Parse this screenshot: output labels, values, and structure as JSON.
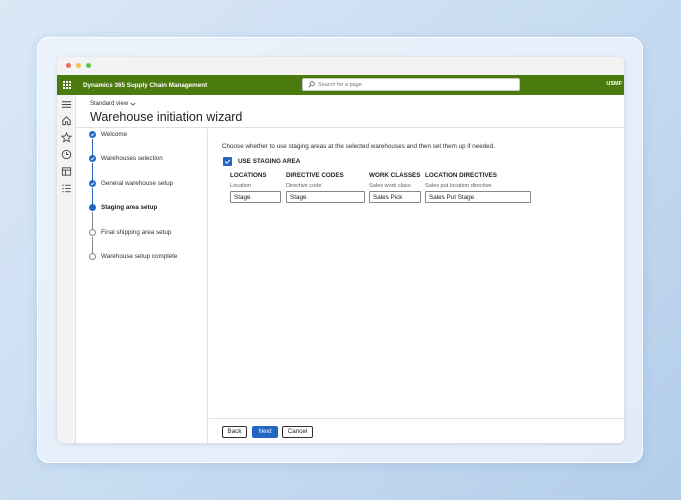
{
  "app": {
    "title": "Dynamics 365 Supply Chain Management",
    "company": "USMF",
    "search_placeholder": "Search for a page"
  },
  "header": {
    "view_label": "Standard view",
    "title": "Warehouse initiation wizard"
  },
  "steps": [
    {
      "label": "Welcome",
      "status": "done"
    },
    {
      "label": "Warehouses selection",
      "status": "done"
    },
    {
      "label": "General warehouse setup",
      "status": "done"
    },
    {
      "label": "Staging area setup",
      "status": "current"
    },
    {
      "label": "Final shipping area setup",
      "status": "future"
    },
    {
      "label": "Warehouse setup complete",
      "status": "future"
    }
  ],
  "content": {
    "instructions": "Choose whether to use staging areas at the selected warehouses and then set them up if needed.",
    "checkbox_label": "USE STAGING AREA",
    "checkbox_checked": true,
    "groups": [
      {
        "heading": "LOCATIONS",
        "field_label": "Location",
        "value": "Stage"
      },
      {
        "heading": "DIRECTIVE CODES",
        "field_label": "Directive code",
        "value": "Stage"
      },
      {
        "heading": "WORK CLASSES",
        "field_label": "Sales work class",
        "value": "Sales Pick"
      },
      {
        "heading": "LOCATION DIRECTIVES",
        "field_label": "Sales put location directive",
        "value": "Sales Put Stage"
      }
    ]
  },
  "footer": {
    "back_label": "Back",
    "next_label": "Next",
    "cancel_label": "Cancel"
  },
  "colors": {
    "appbar": "#4b7a0f",
    "accent": "#2266c2"
  },
  "icons": {
    "nav": [
      "hamburger-icon",
      "home-icon",
      "star-icon",
      "clock-icon",
      "workspace-icon",
      "list-icon"
    ],
    "search": "search-icon",
    "view_dropdown": "chevron-down-icon"
  }
}
